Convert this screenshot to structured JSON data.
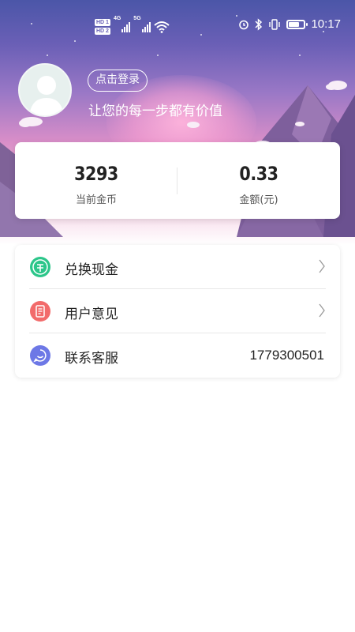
{
  "status_bar": {
    "network_label": "4G",
    "network_label_2": "5G",
    "time": "10:17",
    "icons": [
      "hd-icon",
      "signal-icon",
      "wifi-icon",
      "alarm-icon",
      "bluetooth-icon",
      "vibrate-icon",
      "battery-icon"
    ]
  },
  "profile": {
    "login_button": "点击登录",
    "tagline": "让您的每一步都有价值",
    "avatar_icon": "default-avatar-icon"
  },
  "stats": {
    "coins_value": "3293",
    "coins_label": "当前金币",
    "amount_value": "0.33",
    "amount_label": "金额(元)"
  },
  "menu": {
    "items": [
      {
        "label": "兑换现金",
        "icon": "cash-exchange-icon",
        "color": "#2cc68a",
        "has_chevron": true
      },
      {
        "label": "用户意见",
        "icon": "feedback-icon",
        "color": "#f26b6b",
        "has_chevron": true
      },
      {
        "label": "联系客服",
        "icon": "customer-service-icon",
        "color": "#6d78e6",
        "value": "1779300501"
      }
    ]
  },
  "colors": {
    "hero_top": "#4b56a8",
    "hero_glow": "#f7a6d6",
    "card_bg": "#ffffff",
    "text_primary": "#222222"
  }
}
